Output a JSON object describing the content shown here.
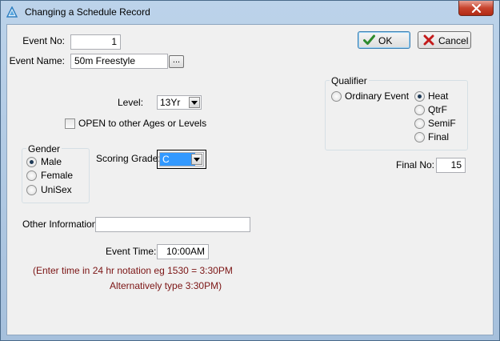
{
  "window": {
    "title": "Changing a Schedule Record"
  },
  "toolbar": {
    "ok_label": "OK",
    "cancel_label": "Cancel"
  },
  "form": {
    "event_no_label": "Event No:",
    "event_no_value": "1",
    "event_name_label": "Event Name:",
    "event_name_value": "50m Freestyle",
    "browse_label": "...",
    "level_label": "Level:",
    "level_value": "13Yr",
    "open_label": "OPEN to other Ages or Levels",
    "scoring_grade_label": "Scoring Grade:",
    "scoring_grade_value": "C",
    "final_no_label": "Final No:",
    "final_no_value": "15",
    "other_info_label": "Other Information:",
    "other_info_value": "",
    "event_time_label": "Event Time:",
    "event_time_value": "10:00AM",
    "hint_line1": "(Enter time in 24 hr notation eg 1530 = 3:30PM",
    "hint_line2": "Alternatively type 3:30PM)"
  },
  "gender": {
    "title": "Gender",
    "options": [
      "Male",
      "Female",
      "UniSex"
    ],
    "selected": "Male"
  },
  "qualifier": {
    "title": "Qualifier",
    "ordinary_label": "Ordinary Event",
    "options": [
      "Heat",
      "QtrF",
      "SemiF",
      "Final"
    ],
    "selected": "Heat"
  },
  "colors": {
    "hint_text": "#7b1414",
    "titlebar": "#bcd3ea"
  }
}
